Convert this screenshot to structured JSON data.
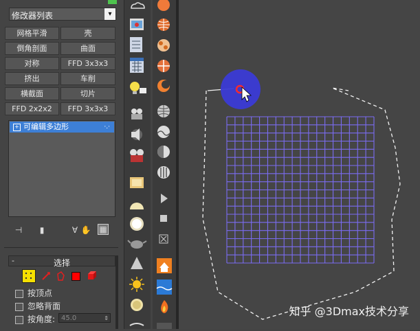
{
  "modifier_list": {
    "label": "修改器列表",
    "arrow": "▾"
  },
  "modifier_buttons": [
    [
      "网格平滑",
      "壳"
    ],
    [
      "倒角剖面",
      "曲面"
    ],
    [
      "对称",
      "FFD 3x3x3"
    ],
    [
      "挤出",
      "车削"
    ],
    [
      "横截面",
      "切片"
    ],
    [
      "FFD 2x2x2",
      "FFD 3x3x3"
    ]
  ],
  "stack": {
    "item": "可编辑多边形",
    "expander": "+"
  },
  "selection": {
    "title": "选择",
    "collapse": "-",
    "checkboxes": [
      "按顶点",
      "忽略背面",
      "按角度:"
    ],
    "angle_value": "45.0",
    "icon_colors": {
      "vertex": "#f5e000",
      "active": "#ff0000"
    }
  },
  "viewport": {
    "watermark": "知乎 @3Dmax技术分享",
    "grid_color": "#7b6cf2",
    "cursor_circle_color": "#3d3de0"
  },
  "toolbar_icons_left": [
    "cloud-icon",
    "render-frame-icon",
    "list-icon",
    "calendar-icon",
    "light-bulb-icon",
    "camera-icon",
    "film-icon",
    "box-material-icon",
    "sphere-icon",
    "hemisphere-icon",
    "teapot-icon",
    "cone-icon",
    "sun-icon",
    "disc-icon"
  ],
  "toolbar_icons_right": [
    "sphere-orange-icon",
    "globe-icon",
    "checker-sphere-icon",
    "tile-sphere-icon",
    "moon-icon",
    "globe-grey-icon",
    "wave-sphere-icon",
    "half-sphere-icon",
    "bars-sphere-icon",
    "play-icon",
    "stop-icon",
    "close-box-icon",
    "house-icon",
    "water-icon",
    "fire-icon"
  ]
}
